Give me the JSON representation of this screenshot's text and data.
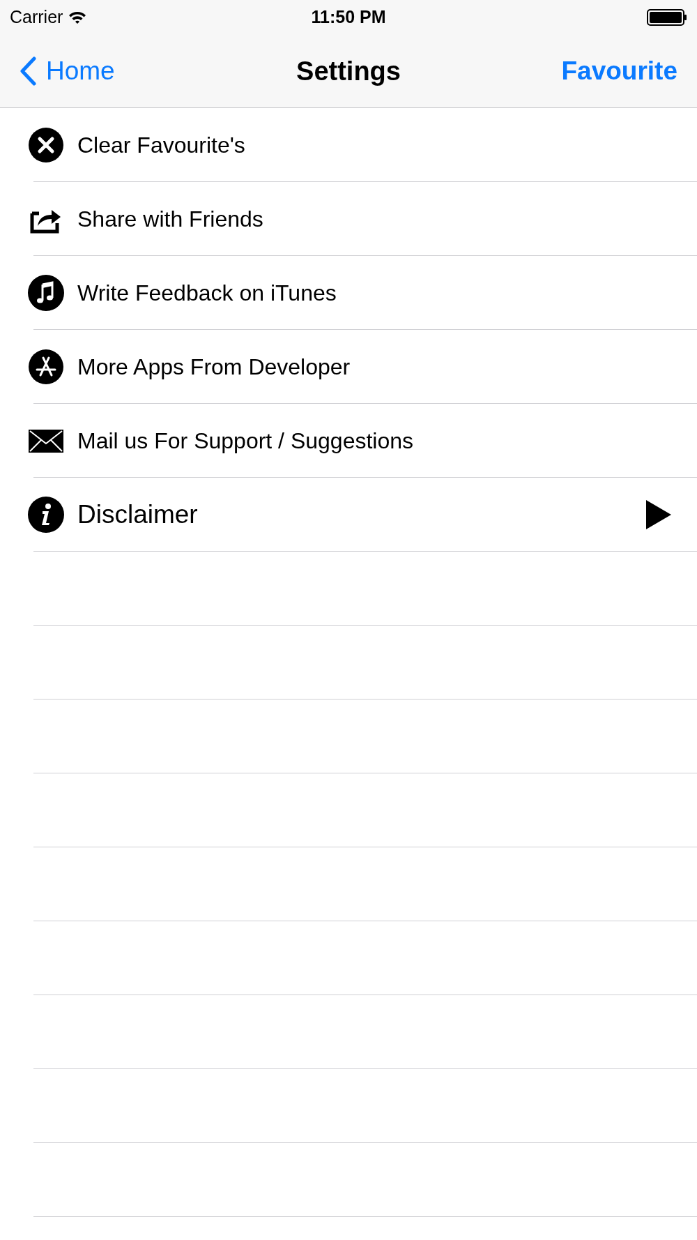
{
  "status_bar": {
    "carrier": "Carrier",
    "time": "11:50 PM"
  },
  "nav_bar": {
    "back": "Home",
    "title": "Settings",
    "action": "Favourite"
  },
  "items": [
    {
      "label": "Clear Favourite's",
      "kind": "plain"
    },
    {
      "label": "Share with Friends",
      "kind": "plain"
    },
    {
      "label": "Write Feedback on iTunes",
      "kind": "plain"
    },
    {
      "label": "More Apps From Developer",
      "kind": "plain"
    },
    {
      "label": "Mail us For Support / Suggestions",
      "kind": "plain"
    },
    {
      "label": "Disclaimer",
      "kind": "disclosure"
    }
  ]
}
